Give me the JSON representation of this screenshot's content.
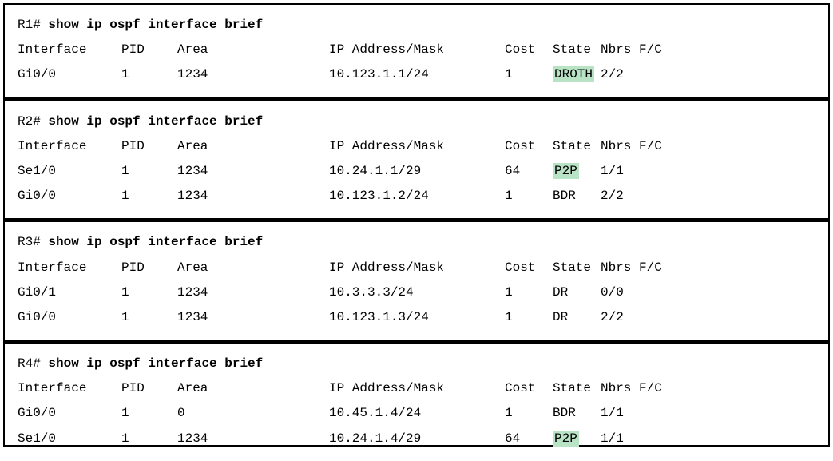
{
  "headers": {
    "int": "Interface",
    "pid": "PID",
    "area": "Area",
    "ip": "IP Address/Mask",
    "cost": "Cost",
    "state": "State",
    "nbrs": "Nbrs F/C"
  },
  "blocks": [
    {
      "prompt": "R1# ",
      "command": "show ip ospf interface brief",
      "rows": [
        {
          "int": "Gi0/0",
          "pid": "1",
          "area": "1234",
          "ip": "10.123.1.1/24",
          "cost": "1",
          "state": "DROTH",
          "state_hl": true,
          "nbrs": "2/2"
        }
      ]
    },
    {
      "prompt": "R2# ",
      "command": "show ip ospf interface brief",
      "rows": [
        {
          "int": "Se1/0",
          "pid": "1",
          "area": "1234",
          "ip": "10.24.1.1/29",
          "cost": "64",
          "state": "P2P",
          "state_hl": true,
          "nbrs": "1/1"
        },
        {
          "int": "Gi0/0",
          "pid": "1",
          "area": "1234",
          "ip": "10.123.1.2/24",
          "cost": "1",
          "state": "BDR",
          "state_hl": false,
          "nbrs": "2/2"
        }
      ]
    },
    {
      "prompt": "R3# ",
      "command": "show ip ospf interface brief",
      "rows": [
        {
          "int": "Gi0/1",
          "pid": "1",
          "area": "1234",
          "ip": "10.3.3.3/24",
          "cost": "1",
          "state": "DR",
          "state_hl": false,
          "nbrs": "0/0"
        },
        {
          "int": "Gi0/0",
          "pid": "1",
          "area": "1234",
          "ip": "10.123.1.3/24",
          "cost": "1",
          "state": "DR",
          "state_hl": false,
          "nbrs": "2/2"
        }
      ]
    },
    {
      "prompt": "R4# ",
      "command": "show ip ospf interface brief",
      "rows": [
        {
          "int": "Gi0/0",
          "pid": "1",
          "area": "0",
          "ip": "10.45.1.4/24",
          "cost": "1",
          "state": "BDR",
          "state_hl": false,
          "nbrs": "1/1"
        },
        {
          "int": "Se1/0",
          "pid": "1",
          "area": "1234",
          "ip": "10.24.1.4/29",
          "cost": "64",
          "state": "P2P",
          "state_hl": true,
          "nbrs": "1/1"
        }
      ]
    }
  ]
}
